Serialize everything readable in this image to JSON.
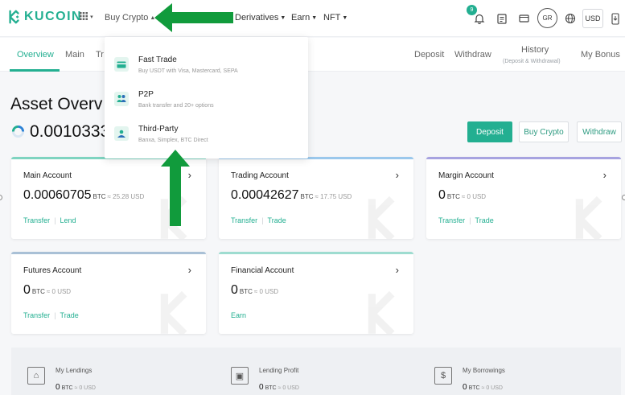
{
  "brand": {
    "name": "KUCOIN",
    "color": "#23af91"
  },
  "nav": {
    "buy_crypto": "Buy Crypto",
    "derivatives": "Derivatives",
    "earn": "Earn",
    "nft": "NFT",
    "notification_count": "9",
    "avatar_initials": "GR",
    "currency": "USD",
    "icons": [
      "apps-grid-icon",
      "bell-icon",
      "orders-icon",
      "wallet-icon",
      "globe-icon",
      "download-app-icon"
    ]
  },
  "subnav": {
    "tabs": [
      "Overview",
      "Main",
      "Tr"
    ],
    "active_tab": "Overview",
    "right": {
      "deposit": "Deposit",
      "withdraw": "Withdraw",
      "history": "History",
      "history_sub": "(Deposit & Withdrawal)",
      "my_bonus": "My Bonus"
    }
  },
  "overview": {
    "title": "Asset Overv",
    "total": "0.0010333",
    "deposit_btn": "Deposit",
    "buy_btn": "Buy Crypto",
    "withdraw_btn": "Withdraw"
  },
  "accounts": [
    {
      "title": "Main Account",
      "value": "0.00060705",
      "unit": "BTC",
      "approx": "≈ 25.28 USD",
      "links": [
        "Transfer",
        "Lend"
      ],
      "accent": "#7fd4c1"
    },
    {
      "title": "Trading Account",
      "value": "0.00042627",
      "unit": "BTC",
      "approx": "≈ 17.75 USD",
      "links": [
        "Transfer",
        "Trade"
      ],
      "accent": "#9bc8ec"
    },
    {
      "title": "Margin Account",
      "value": "0",
      "unit": "BTC",
      "approx": "≈ 0 USD",
      "links": [
        "Transfer",
        "Trade"
      ],
      "accent": "#a7a3e0"
    },
    {
      "title": "Futures Account",
      "value": "0",
      "unit": "BTC",
      "approx": "≈ 0 USD",
      "links": [
        "Transfer",
        "Trade"
      ],
      "accent": "#a9c0d6"
    },
    {
      "title": "Financial Account",
      "value": "0",
      "unit": "BTC",
      "approx": "≈ 0 USD",
      "links": [
        "Earn"
      ],
      "accent": "#9edcd0"
    }
  ],
  "lending": [
    {
      "label": "My Lendings",
      "value": "0",
      "unit": "BTC",
      "approx": "≈ 0 USD",
      "icon": "house-icon"
    },
    {
      "label": "Lending Profit",
      "value": "0",
      "unit": "BTC",
      "approx": "≈ 0 USD",
      "icon": "gift-icon"
    },
    {
      "label": "My Borrowings",
      "value": "0",
      "unit": "BTC",
      "approx": "≈ 0 USD",
      "icon": "money-bag-icon"
    }
  ],
  "dropdown": [
    {
      "title": "Fast Trade",
      "desc": "Buy USDT with Visa, Mastercard, SEPA",
      "icon": "card-icon"
    },
    {
      "title": "P2P",
      "desc": "Bank transfer and 20+ options",
      "icon": "p2p-icon"
    },
    {
      "title": "Third-Party",
      "desc": "Banxa, Simplex, BTC Direct",
      "icon": "third-party-icon"
    }
  ],
  "annotation_color": "#119b3c"
}
